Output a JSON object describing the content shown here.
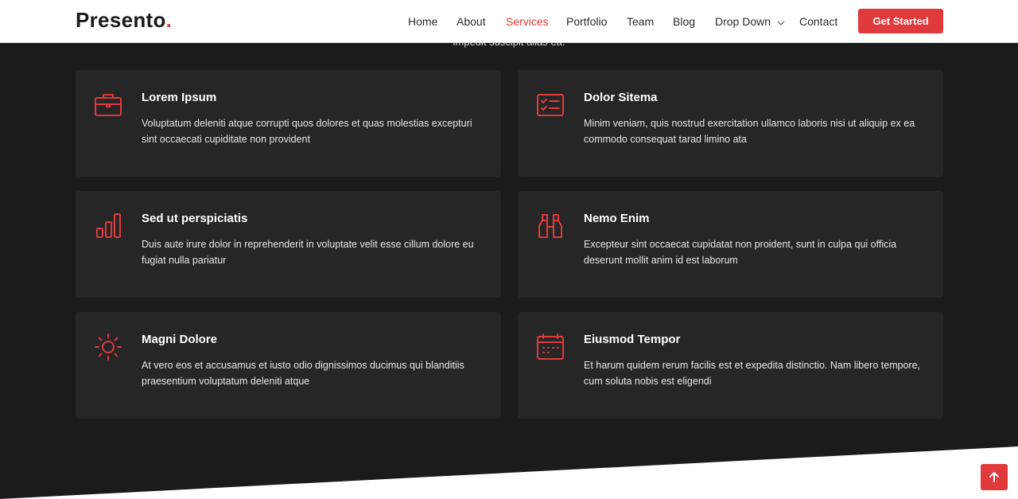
{
  "brand": {
    "name": "Presento",
    "dot": "."
  },
  "nav": {
    "items": [
      {
        "label": "Home"
      },
      {
        "label": "About"
      },
      {
        "label": "Services"
      },
      {
        "label": "Portfolio"
      },
      {
        "label": "Team"
      },
      {
        "label": "Blog"
      },
      {
        "label": "Drop Down"
      },
      {
        "label": "Contact"
      }
    ],
    "active": "Services",
    "cta_label": "Get Started"
  },
  "intro": {
    "text": "impedit suscipit alias ea."
  },
  "services": [
    {
      "icon": "briefcase-icon",
      "title": "Lorem Ipsum",
      "description": "Voluptatum deleniti atque corrupti quos dolores et quas molestias excepturi sint occaecati cupiditate non provident"
    },
    {
      "icon": "card-checklist-icon",
      "title": "Dolor Sitema",
      "description": "Minim veniam, quis nostrud exercitation ullamco laboris nisi ut aliquip ex ea commodo consequat tarad limino ata"
    },
    {
      "icon": "bar-chart-icon",
      "title": "Sed ut perspiciatis",
      "description": "Duis aute irure dolor in reprehenderit in voluptate velit esse cillum dolore eu fugiat nulla pariatur"
    },
    {
      "icon": "binoculars-icon",
      "title": "Nemo Enim",
      "description": "Excepteur sint occaecat cupidatat non proident, sunt in culpa qui officia deserunt mollit anim id est laborum"
    },
    {
      "icon": "sun-icon",
      "title": "Magni Dolore",
      "description": "At vero eos et accusamus et iusto odio dignissimos ducimus qui blanditiis praesentium voluptatum deleniti atque"
    },
    {
      "icon": "calendar-icon",
      "title": "Eiusmod Tempor",
      "description": "Et harum quidem rerum facilis est et expedita distinctio. Nam libero tempore, cum soluta nobis est eligendi"
    }
  ],
  "colors": {
    "accent": "#e03a3c",
    "section_bg": "#1b1b1c",
    "card_bg": "#262627",
    "header_bg": "#ffffff"
  },
  "back_to_top": {
    "icon": "arrow-up-icon"
  }
}
